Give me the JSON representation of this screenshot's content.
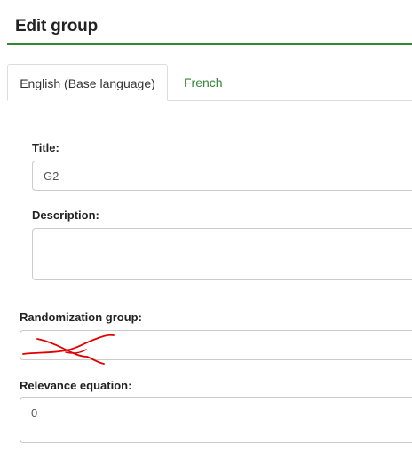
{
  "header": {
    "title": "Edit group"
  },
  "tabs": [
    {
      "label": "English (Base language)",
      "active": true
    },
    {
      "label": "French",
      "active": false
    }
  ],
  "form": {
    "title": {
      "label": "Title:",
      "value": "G2"
    },
    "description": {
      "label": "Description:",
      "value": ""
    },
    "randomization_group": {
      "label": "Randomization group:",
      "value": ""
    },
    "relevance_equation": {
      "label": "Relevance equation:",
      "value": "0"
    }
  },
  "colors": {
    "accent": "#328637",
    "annotation": "#e00000"
  }
}
